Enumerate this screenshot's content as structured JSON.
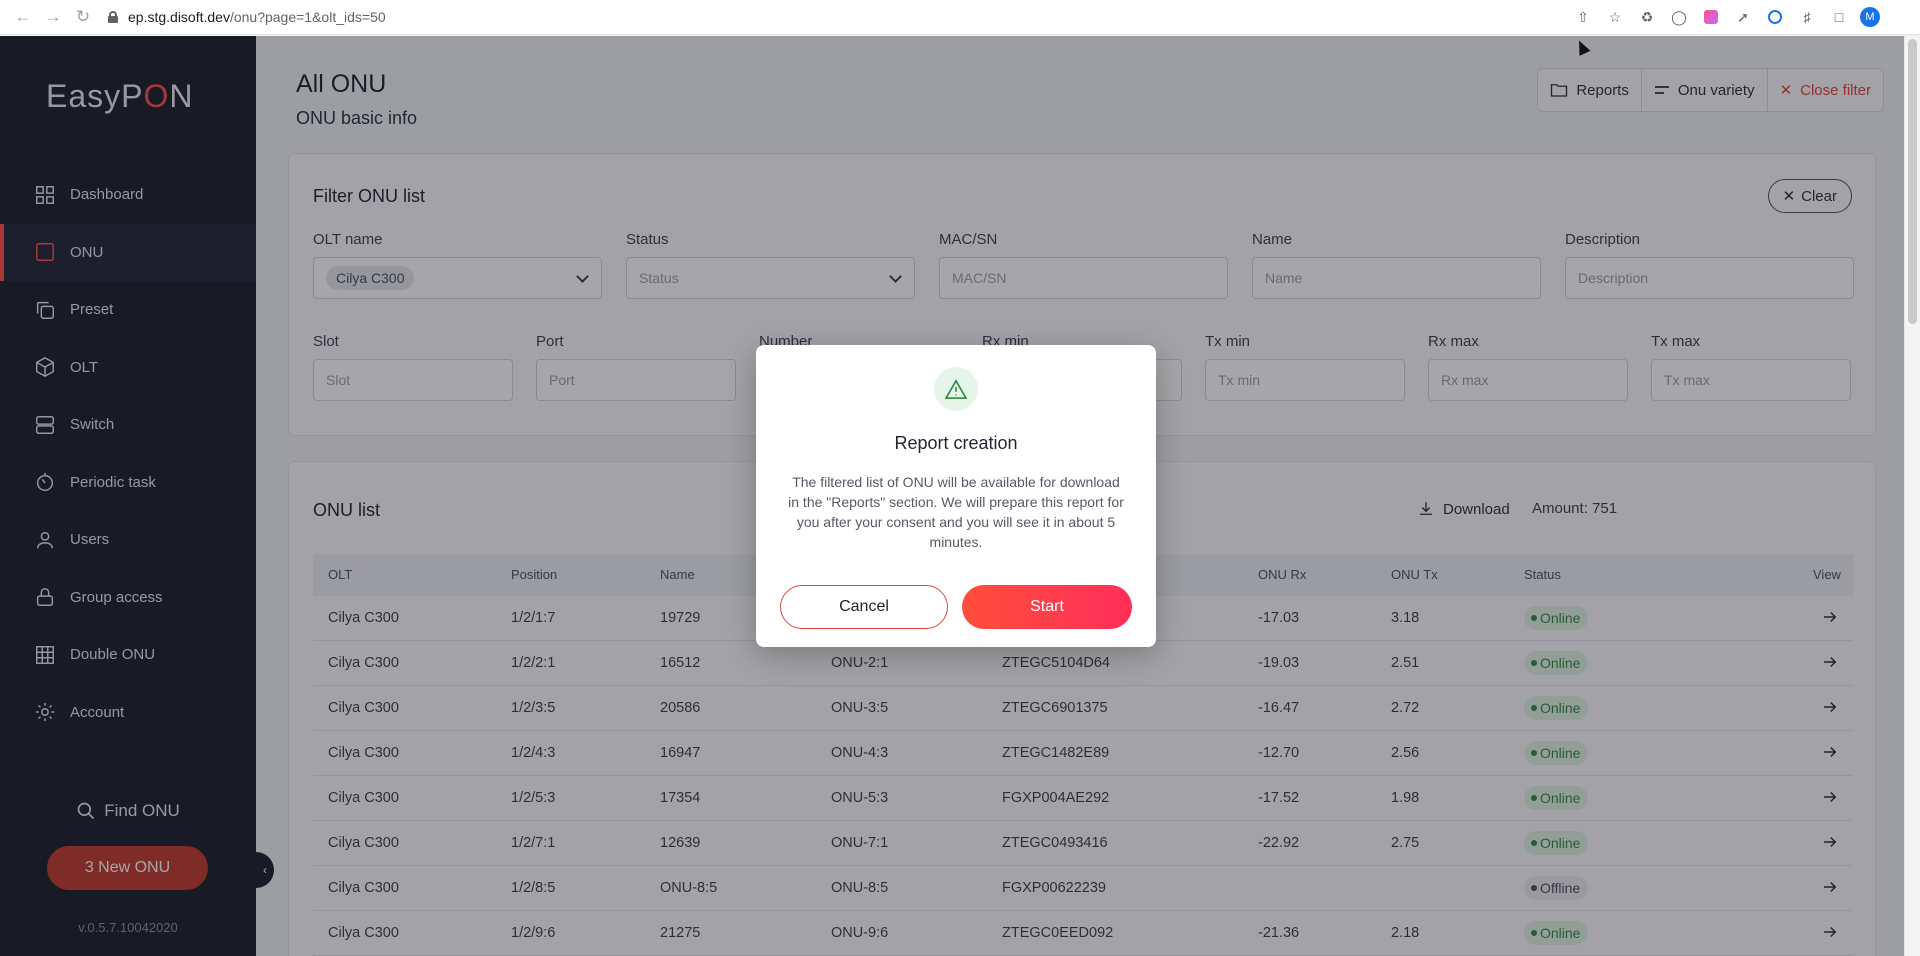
{
  "browser": {
    "url_host": "ep.stg.disoft.dev",
    "url_path": "/onu?page=1&olt_ids=50",
    "profile_initial": "M"
  },
  "sidebar": {
    "logo_prefix": "EasyP",
    "logo_o": "O",
    "logo_suffix": "N",
    "items": [
      {
        "label": "Dashboard",
        "icon": "grid-icon"
      },
      {
        "label": "ONU",
        "icon": "square-icon"
      },
      {
        "label": "Preset",
        "icon": "copy-icon"
      },
      {
        "label": "OLT",
        "icon": "cube-icon"
      },
      {
        "label": "Switch",
        "icon": "server-icon"
      },
      {
        "label": "Periodic task",
        "icon": "timer-icon"
      },
      {
        "label": "Users",
        "icon": "user-icon"
      },
      {
        "label": "Group access",
        "icon": "lock-icon"
      },
      {
        "label": "Double ONU",
        "icon": "table-grid-icon"
      },
      {
        "label": "Account",
        "icon": "gear-icon"
      }
    ],
    "find_label": "Find ONU",
    "new_onu_label": "3 New ONU",
    "version": "v.0.5.7.10042020"
  },
  "header": {
    "title": "All ONU",
    "subtitle": "ONU basic info",
    "reports_label": "Reports",
    "variety_label": "Onu variety",
    "close_filter_label": "Close filter"
  },
  "filter": {
    "title": "Filter ONU list",
    "clear_label": "Clear",
    "olt_name_label": "OLT name",
    "olt_name_value": "Cilya C300",
    "status_label": "Status",
    "status_placeholder": "Status",
    "mac_label": "MAC/SN",
    "mac_placeholder": "MAC/SN",
    "name_label": "Name",
    "name_placeholder": "Name",
    "description_label": "Description",
    "description_placeholder": "Description",
    "slot_label": "Slot",
    "slot_placeholder": "Slot",
    "port_label": "Port",
    "port_placeholder": "Port",
    "number_label": "Number",
    "rx_min_label": "Rx min",
    "tx_min_label": "Tx min",
    "tx_min_placeholder": "Tx min",
    "rx_max_label": "Rx max",
    "rx_max_placeholder": "Rx max",
    "tx_max_label": "Tx max",
    "tx_max_placeholder": "Tx max"
  },
  "list": {
    "title": "ONU list",
    "download_label": "Download",
    "amount": "Amount: 751",
    "columns": [
      "OLT",
      "Position",
      "Name",
      "ONU Rx",
      "ONU Tx",
      "Status",
      "View"
    ],
    "rows": [
      {
        "olt": "Cilya C300",
        "position": "1/2/1:7",
        "name": "19729",
        "onu": "",
        "sn": "",
        "rx": "-17.03",
        "tx": "3.18",
        "status": "Online"
      },
      {
        "olt": "Cilya C300",
        "position": "1/2/2:1",
        "name": "16512",
        "onu": "ONU-2:1",
        "sn": "ZTEGC5104D64",
        "rx": "-19.03",
        "tx": "2.51",
        "status": "Online"
      },
      {
        "olt": "Cilya C300",
        "position": "1/2/3:5",
        "name": "20586",
        "onu": "ONU-3:5",
        "sn": "ZTEGC6901375",
        "rx": "-16.47",
        "tx": "2.72",
        "status": "Online"
      },
      {
        "olt": "Cilya C300",
        "position": "1/2/4:3",
        "name": "16947",
        "onu": "ONU-4:3",
        "sn": "ZTEGC1482E89",
        "rx": "-12.70",
        "tx": "2.56",
        "status": "Online"
      },
      {
        "olt": "Cilya C300",
        "position": "1/2/5:3",
        "name": "17354",
        "onu": "ONU-5:3",
        "sn": "FGXP004AE292",
        "rx": "-17.52",
        "tx": "1.98",
        "status": "Online"
      },
      {
        "olt": "Cilya C300",
        "position": "1/2/7:1",
        "name": "12639",
        "onu": "ONU-7:1",
        "sn": "ZTEGC0493416",
        "rx": "-22.92",
        "tx": "2.75",
        "status": "Online"
      },
      {
        "olt": "Cilya C300",
        "position": "1/2/8:5",
        "name": "ONU-8:5",
        "onu": "ONU-8:5",
        "sn": "FGXP00622239",
        "rx": "",
        "tx": "",
        "status": "Offline"
      },
      {
        "olt": "Cilya C300",
        "position": "1/2/9:6",
        "name": "21275",
        "onu": "ONU-9:6",
        "sn": "ZTEGC0EED092",
        "rx": "-21.36",
        "tx": "2.18",
        "status": "Online"
      }
    ]
  },
  "modal": {
    "title": "Report creation",
    "text": "The filtered list of ONU will be available for download in the \"Reports\" section. We will prepare this report for you after your consent and you will see it in about 5 minutes.",
    "cancel_label": "Cancel",
    "start_label": "Start"
  },
  "colors": {
    "accent": "#ff4e45",
    "sidebar_bg": "#1a1d2c",
    "online": "#2f8a45"
  }
}
